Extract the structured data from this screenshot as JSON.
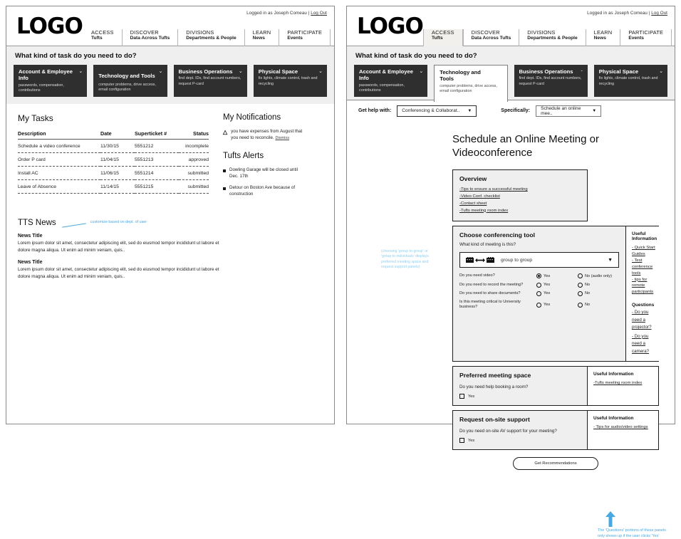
{
  "header": {
    "logo": "LOGO",
    "login_text": "Logged in as Joseph Comeau  |  ",
    "logout_label": "Log Out",
    "nav": [
      {
        "top": "ACCESS",
        "bottom": "Tufts"
      },
      {
        "top": "DISCOVER",
        "bottom": "Data Across Tufts"
      },
      {
        "top": "DIVISIONS",
        "bottom": "Departments & People"
      },
      {
        "top": "LEARN",
        "bottom": "News"
      },
      {
        "top": "PARTICIPATE",
        "bottom": "Events"
      }
    ]
  },
  "task_band": {
    "question": "What kind of task do you need to do?",
    "cards": [
      {
        "title": "Account & Employee Info",
        "sub": "passwords, compensation, contributions",
        "chevron": "⌄"
      },
      {
        "title": "Technology and Tools",
        "sub": "computer problems, drive access, email configuration",
        "chevron": "⌄"
      },
      {
        "title": "Business Operations",
        "sub": "find dept. IDs, find account numbers, request P-card",
        "chevron": "⌄"
      },
      {
        "title": "Physical Space",
        "sub": "fix lights, climate control, trash and recycling",
        "chevron": "⌄"
      }
    ]
  },
  "left_panel": {
    "my_tasks": {
      "heading": "My Tasks",
      "columns": [
        "Description",
        "Date",
        "Superticket #",
        "Status"
      ],
      "rows": [
        {
          "description": "Schedule a video conference",
          "date": "11/30/15",
          "ticket": "5551212",
          "status": "incomplete"
        },
        {
          "description": "Order P card",
          "date": "11/04/15",
          "ticket": "5551213",
          "status": "approved"
        },
        {
          "description": "Install AC",
          "date": "11/06/15",
          "ticket": "5551214",
          "status": "submitted"
        },
        {
          "description": "Leave of Absence",
          "date": "11/14/15",
          "ticket": "5551215",
          "status": "submitted"
        }
      ]
    },
    "notifications": {
      "heading": "My Notifications",
      "icon": "warning-triangle-icon",
      "text": "you have expenses from August that you need to reconcile.",
      "dismiss_label": "Dismiss"
    },
    "alerts": {
      "heading": "Tufts Alerts",
      "items": [
        "Dowling Garage will be closed until Dec. 17th",
        "Detour on Boston Ave because of construction"
      ]
    },
    "news": {
      "heading": "TTS News",
      "annotation": "customize based on dept. of user",
      "items": [
        {
          "title": "News Title",
          "body": "Lorem ipsum dolor sit amet, consectetur adipiscing elit, sed do eiusmod tempor incididunt ut labore et dolore magna aliqua. Ut enim ad minim veniam, quis.."
        },
        {
          "title": "News Title",
          "body": "Lorem ipsum dolor sit amet, consectetur adipiscing elit, sed do eiusmod tempor incididunt ut labore et dolore magna aliqua. Ut enim ad minim veniam, quis.."
        }
      ]
    }
  },
  "right_panel": {
    "helpbar": {
      "label1": "Get help with:",
      "value1": "Conferencing & Collaborat..",
      "label2": "Specifically:",
      "value2": "Schedule an online mee..",
      "caret": "▼"
    },
    "page_title": "Schedule an Online Meeting or Videoconference",
    "overview": {
      "heading": "Overview",
      "links": [
        "-Tips to ensure a successful meeting",
        "-Video Conf. checklist",
        "-Contact sheet",
        "-Tufts meeting room index"
      ]
    },
    "conferencing": {
      "heading": "Choose conferencing tool",
      "question": "What kind of meeting is this?",
      "selected_tool": "group to group",
      "tool_icon": "group-to-group-icon",
      "caret": "▼",
      "radio_rows": [
        {
          "q": "Do you need video?",
          "yes": "Yes",
          "no": "No (audio only)",
          "checked": "yes"
        },
        {
          "q": "Do you need to record the meeting?",
          "yes": "Yes",
          "no": "No",
          "checked": ""
        },
        {
          "q": "Do you need to share documents?",
          "yes": "Yes",
          "no": "No",
          "checked": ""
        },
        {
          "q": "Is this meeting critical to University business?",
          "yes": "Yes",
          "no": "No",
          "checked": ""
        }
      ],
      "side": {
        "heading": "Useful Information",
        "links": [
          "- Quick Start Guides",
          "- Test conference tools",
          "- tips for remote participants"
        ],
        "questions_heading": "Questions",
        "questions": [
          "- Do you need a projector?",
          "- Do you need a camera?"
        ]
      }
    },
    "meeting_space": {
      "heading": "Preferred meeting space",
      "question": "Do you need help booking a room?",
      "checkbox_label": "Yes",
      "side": {
        "heading": "Useful Information",
        "links": [
          "-Tufts meeting room index"
        ]
      }
    },
    "onsite_support": {
      "heading": "Request on-site support",
      "question": "Do you need on-site AV support for your meeting?",
      "checkbox_label": "Yes",
      "side": {
        "heading": "Useful Information",
        "links": [
          "- Tips for audio/video settings"
        ]
      }
    },
    "submit_label": "Get Recommendations",
    "annotation_left": "(choosing 'group to group' or 'group to individuals' displays preferred meeting space  and request support panels)",
    "annotation_bottom": "The 'Questions' portions of these panels only shows up if the user clicks 'Yes'"
  },
  "colors": {
    "card_bg": "#2f2f2f",
    "band_bg": "#efefef",
    "annotation_blue": "#4aa8e0",
    "frame": "#8a8a8a"
  }
}
